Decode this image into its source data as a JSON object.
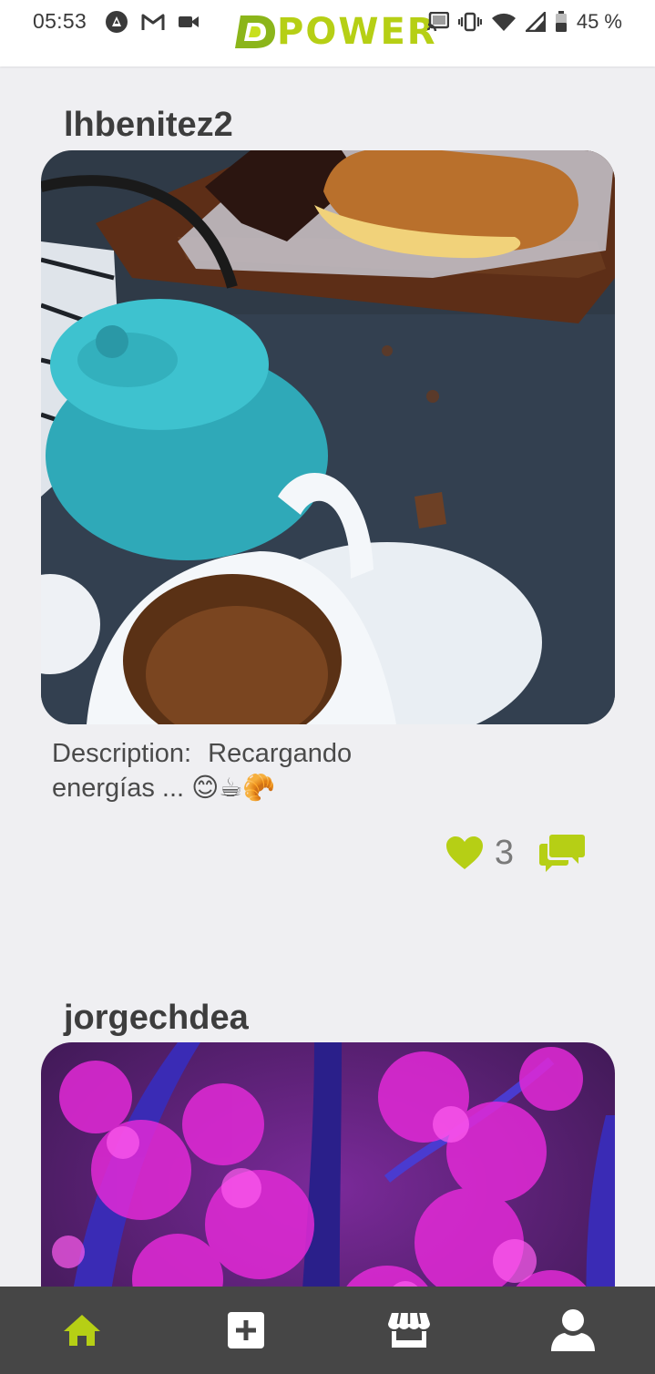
{
  "status_bar": {
    "time": "05:53",
    "battery": "45 %",
    "icons_left": [
      "assistant-icon",
      "gmail-icon",
      "video-icon"
    ],
    "icons_right": [
      "cast-icon",
      "vibrate-icon",
      "wifi-icon",
      "signal-icon",
      "battery-icon"
    ]
  },
  "header": {
    "brand": "POWER",
    "logo_letter": "D"
  },
  "colors": {
    "accent": "#b6cf15",
    "nav_bg": "#464646",
    "background": "#efeff2"
  },
  "posts": [
    {
      "username": "lhbenitez2",
      "description_label": "Description:",
      "description_text": "Recargando energías ... 😊☕🥐",
      "likes": "3",
      "image_subject": "teapot-and-tea-photo"
    },
    {
      "username": "jorgechdea",
      "image_subject": "purple-lit-trees-photo"
    }
  ],
  "bottom_nav": [
    {
      "name": "home",
      "icon": "home-icon",
      "active": true
    },
    {
      "name": "add",
      "icon": "add-icon",
      "active": false
    },
    {
      "name": "store",
      "icon": "store-icon",
      "active": false
    },
    {
      "name": "profile",
      "icon": "user-icon",
      "active": false
    }
  ]
}
